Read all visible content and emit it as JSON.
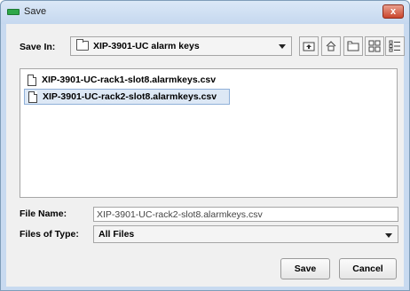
{
  "window": {
    "title": "Save",
    "close_glyph": "x"
  },
  "save_in": {
    "label": "Save In:",
    "folder": "XIP-3901-UC alarm keys"
  },
  "toolbar": {
    "icons": [
      "up-one-level-icon",
      "home-icon",
      "new-folder-icon",
      "list-view-icon",
      "details-view-icon"
    ]
  },
  "files": [
    {
      "name": "XIP-3901-UC-rack1-slot8.alarmkeys.csv",
      "selected": false
    },
    {
      "name": "XIP-3901-UC-rack2-slot8.alarmkeys.csv",
      "selected": true
    }
  ],
  "file_name": {
    "label": "File Name:",
    "value": "XIP-3901-UC-rack2-slot8.alarmkeys.csv"
  },
  "file_type": {
    "label": "Files of Type:",
    "selected": "All Files"
  },
  "buttons": {
    "save": "Save",
    "cancel": "Cancel"
  }
}
